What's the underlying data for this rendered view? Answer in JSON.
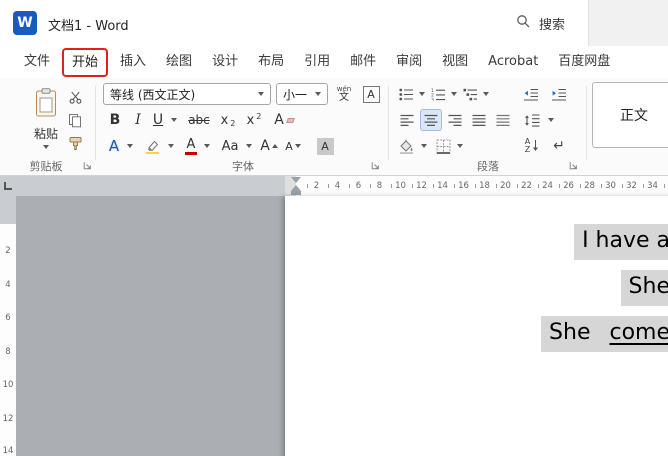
{
  "titlebar": {
    "app_icon_letter": "W",
    "title": "文档1 - Word",
    "search_placeholder": "搜索"
  },
  "tabs": [
    "文件",
    "开始",
    "插入",
    "绘图",
    "设计",
    "布局",
    "引用",
    "邮件",
    "审阅",
    "视图",
    "Acrobat",
    "百度网盘"
  ],
  "active_tab": "开始",
  "ribbon": {
    "clipboard": {
      "group_label": "剪贴板",
      "paste_label": "粘贴"
    },
    "font": {
      "group_label": "字体",
      "font_name": "等线 (西文正文)",
      "font_size": "小一",
      "bold": "B",
      "italic": "I",
      "underline": "U",
      "strikethrough": "abc",
      "subscript_base": "x",
      "subscript_small": "2",
      "superscript_base": "x",
      "superscript_small": "2",
      "clear_formatting": "A",
      "text_effects": "A",
      "font_color": "A",
      "change_case": "Aa",
      "grow_font": "A",
      "shrink_font": "A",
      "char_shading": "A",
      "char_border": "A",
      "pinyin_guide": "wén",
      "pinyin_char": "文"
    },
    "paragraph": {
      "group_label": "段落",
      "sort_a": "A",
      "sort_z": "Z",
      "marks_glyph": "↵"
    },
    "styles": {
      "normal_style": "正文"
    }
  },
  "ruler": {
    "h_numbers": [
      "2",
      "4",
      "6",
      "8",
      "10",
      "12",
      "14",
      "16",
      "18",
      "20",
      "22",
      "24",
      "26",
      "28",
      "30",
      "32",
      "34"
    ],
    "v_numbers": [
      "2",
      "4",
      "6",
      "8",
      "10",
      "12",
      "14"
    ]
  },
  "document": {
    "line1": "I have a",
    "line2": "She",
    "line3_part1": "She ",
    "line3_part2": "come"
  },
  "colors": {
    "word_blue": "#185abd",
    "annotation_red": "#dc241f",
    "selection_gray": "#d6d6d6"
  }
}
